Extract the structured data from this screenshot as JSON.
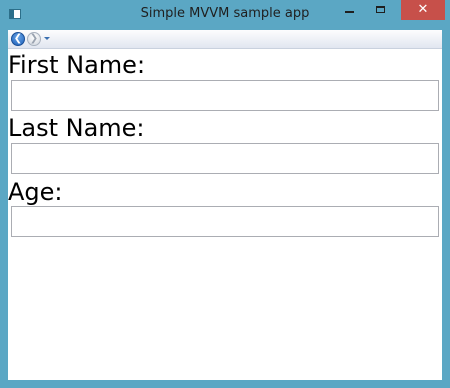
{
  "window": {
    "title": "Simple MVVM sample app",
    "close_glyph": "✕",
    "accent_color": "#5ba7c4",
    "close_color": "#c7504a"
  },
  "nav": {
    "back_glyph": "❮",
    "forward_glyph": "❯"
  },
  "form": {
    "first_name_label": "First Name:",
    "first_name_value": "",
    "last_name_label": "Last Name:",
    "last_name_value": "",
    "age_label": "Age:",
    "age_value": ""
  }
}
